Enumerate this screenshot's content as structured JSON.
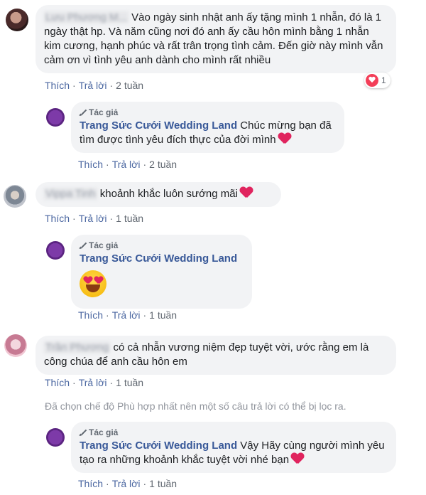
{
  "comments": [
    {
      "user": "Lưu Phương M...",
      "text": "Vào ngày sinh nhật anh ấy tặng mình 1 nhẫn, đó là 1 ngày thật hp. Và năm cũng nơi đó anh ấy cầu hôn mình bằng 1 nhẫn kim cương, hạnh phúc và rất trân trọng tình cảm. Đến giờ này mình vẫn cảm ơn vì tình yêu anh dành cho mình rất nhiều",
      "like": "Thích",
      "reply": "Trả lời",
      "time": "2 tuần",
      "reaction_count": "1"
    },
    {
      "user": "Vippa Tinh",
      "text": "khoảnh khắc luôn sướng mãi",
      "like": "Thích",
      "reply": "Trả lời",
      "time": "1 tuần"
    },
    {
      "user": "Trần Phương",
      "text": "có cả nhẫn vương niệm đẹp tuyệt vời, ước rằng em là công chúa để anh cầu hôn em",
      "like": "Thích",
      "reply": "Trả lời",
      "time": "1 tuần"
    }
  ],
  "replies": [
    {
      "author_tag": "Tác giả",
      "page": "Trang Sức Cưới Wedding Land",
      "text": "Chúc mừng bạn đã tìm được tình yêu đích thực của đời mình",
      "like": "Thích",
      "reply": "Trả lời",
      "time": "2 tuần"
    },
    {
      "author_tag": "Tác giả",
      "page": "Trang Sức Cưới Wedding Land",
      "emoji": "heart-eyes-emoji",
      "like": "Thích",
      "reply": "Trả lời",
      "time": "1 tuần"
    },
    {
      "author_tag": "Tác giả",
      "page": "Trang Sức Cưới Wedding Land",
      "text": "Vậy Hãy cùng người mình yêu tạo ra những khoảnh khắc tuyệt vời nhé bạn",
      "like": "Thích",
      "reply": "Trả lời",
      "time": "1 tuần"
    }
  ],
  "filter_notice": "Đã chọn chế độ Phù hợp nhất nên một số câu trả lời có thể bị lọc ra.",
  "colors": {
    "link": "#385898",
    "bubble": "#f2f3f5",
    "meta": "#606770",
    "heart": "#e0245e"
  }
}
